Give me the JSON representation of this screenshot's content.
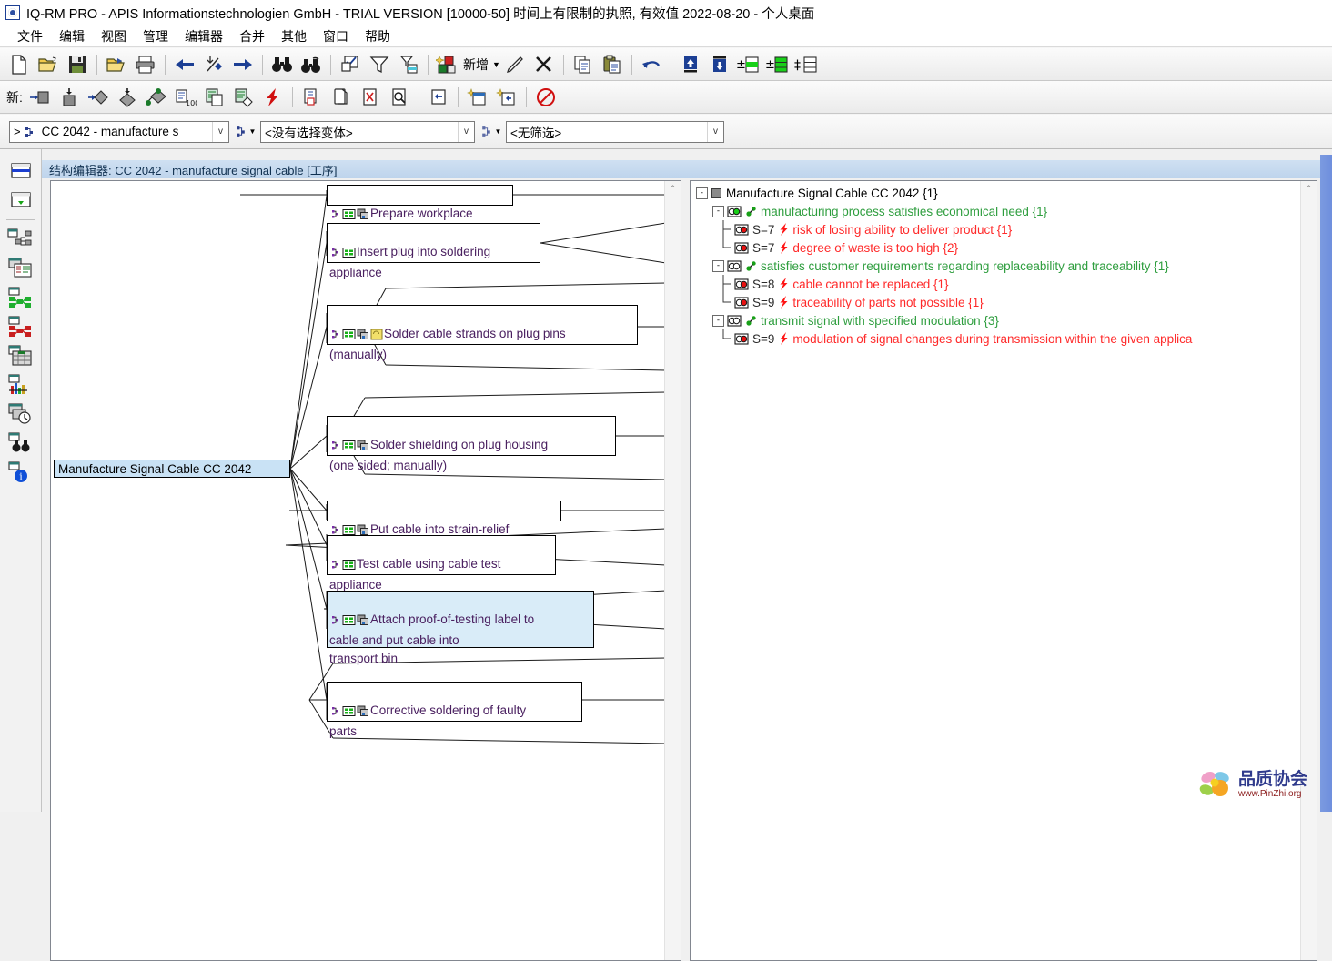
{
  "window": {
    "title": "IQ-RM PRO - APIS Informationstechnologien GmbH -  TRIAL VERSION [10000-50] 时间上有限制的执照, 有效值 2022-08-20 - 个人桌面",
    "app_icon": "apis-app-icon"
  },
  "menubar": {
    "items": [
      {
        "label": "文件",
        "name": "menu-file"
      },
      {
        "label": "编辑",
        "name": "menu-edit"
      },
      {
        "label": "视图",
        "name": "menu-view"
      },
      {
        "label": "管理",
        "name": "menu-manage"
      },
      {
        "label": "编辑器",
        "name": "menu-editor"
      },
      {
        "label": "合并",
        "name": "menu-merge"
      },
      {
        "label": "其他",
        "name": "menu-other"
      },
      {
        "label": "窗口",
        "name": "menu-window"
      },
      {
        "label": "帮助",
        "name": "menu-help"
      }
    ]
  },
  "toolbar_primary": {
    "new_label": "新增",
    "caret": "▼",
    "buttons": [
      {
        "name": "new-document-icon",
        "tip": "新建"
      },
      {
        "name": "open-folder-icon",
        "tip": "打开"
      },
      {
        "name": "save-disk-icon",
        "tip": "保存"
      },
      {
        "name": "print-preview-icon",
        "tip": "打印预览"
      },
      {
        "name": "print-icon",
        "tip": "打印"
      },
      {
        "name": "back-arrow-icon",
        "tip": "后退"
      },
      {
        "name": "jump-to-icon",
        "tip": "跳转"
      },
      {
        "name": "forward-arrow-icon",
        "tip": "前进"
      },
      {
        "name": "find-binoculars-icon",
        "tip": "查找"
      },
      {
        "name": "find-again-binoculars-icon",
        "tip": "再次查找"
      },
      {
        "name": "checkbox-list-icon",
        "tip": "选择"
      },
      {
        "name": "filter-funnel-icon",
        "tip": "筛选"
      },
      {
        "name": "filter-table-icon",
        "tip": "筛选表"
      },
      {
        "name": "new-object-icon",
        "tip": "新增对象"
      },
      {
        "name": "edit-pencil-icon",
        "tip": "编辑"
      },
      {
        "name": "delete-x-icon",
        "tip": "删除"
      },
      {
        "name": "copy-icon",
        "tip": "复制"
      },
      {
        "name": "paste-clipboard-icon",
        "tip": "粘贴"
      },
      {
        "name": "undo-icon",
        "tip": "撤销"
      },
      {
        "name": "move-up-icon",
        "tip": "上移"
      },
      {
        "name": "move-down-icon",
        "tip": "下移"
      },
      {
        "name": "expand-level-icon",
        "tip": "展开层级"
      },
      {
        "name": "expand-all-icon",
        "tip": "全部展开"
      },
      {
        "name": "insert-level-icon",
        "tip": "插入层级"
      }
    ]
  },
  "toolbar_secondary": {
    "prefix_label": "新:",
    "buttons": [
      {
        "name": "new-system-element-icon",
        "tip": "新系统元素"
      },
      {
        "name": "new-element-below-icon",
        "tip": "新元素"
      },
      {
        "name": "new-function-icon",
        "tip": "新功能"
      },
      {
        "name": "new-function-below-icon",
        "tip": "新功能下层"
      },
      {
        "name": "new-characteristic-icon",
        "tip": "新特性"
      },
      {
        "name": "new-measure-100-icon",
        "tip": "新措施"
      },
      {
        "name": "new-form-sheet-icon",
        "tip": "新表单"
      },
      {
        "name": "new-form-characteristic-icon",
        "tip": "新表单特性"
      },
      {
        "name": "new-failure-icon",
        "tip": "新失效"
      },
      {
        "name": "copy-object-icon",
        "tip": "复制对象"
      },
      {
        "name": "duplicate-icon",
        "tip": "副本"
      },
      {
        "name": "delete-object-icon",
        "tip": "删除对象"
      },
      {
        "name": "inspect-object-icon",
        "tip": "检查对象"
      },
      {
        "name": "indent-left-icon",
        "tip": "左缩进"
      },
      {
        "name": "new-row-above-icon",
        "tip": "上方插入行"
      },
      {
        "name": "new-row-right-icon",
        "tip": "右方插入行"
      },
      {
        "name": "no-entry-icon",
        "tip": "禁止"
      }
    ]
  },
  "combo_row": {
    "structure_combo": {
      "value": "CC 2042 - manufacture s",
      "prefix": ">",
      "icon": "structure-icon"
    },
    "variant_combo": {
      "value": "<没有选择变体>"
    },
    "filter_combo": {
      "value": "<无筛选>"
    },
    "mini_button_1": {
      "icon": "structure-small-icon",
      "caret": "▼"
    },
    "mini_button_2": {
      "icon": "variant-small-icon",
      "caret": "▼"
    },
    "dropdown_glyph": "v"
  },
  "document": {
    "title": "结构编辑器: CC 2042 - manufacture signal cable [工序]"
  },
  "sidebar": {
    "items": [
      {
        "name": "sidebar-item-structure-list",
        "icon": "list-blue-bar-icon"
      },
      {
        "name": "sidebar-item-import-down",
        "icon": "list-green-arrow-icon"
      },
      {
        "name": "sidebar-item-structure-tree",
        "icon": "structure-network-icon"
      },
      {
        "name": "sidebar-item-form-sheet",
        "icon": "form-sheet-icon"
      },
      {
        "name": "sidebar-item-function-net",
        "icon": "function-net-green-icon"
      },
      {
        "name": "sidebar-item-failure-net",
        "icon": "failure-net-red-icon"
      },
      {
        "name": "sidebar-item-matrix",
        "icon": "matrix-grid-icon"
      },
      {
        "name": "sidebar-item-chart",
        "icon": "bar-chart-icon"
      },
      {
        "name": "sidebar-item-schedule",
        "icon": "schedule-clock-icon"
      },
      {
        "name": "sidebar-item-search",
        "icon": "binoculars-icon"
      },
      {
        "name": "sidebar-item-info",
        "icon": "info-icon"
      }
    ]
  },
  "graph": {
    "root": {
      "label": "Manufacture Signal Cable CC 2042",
      "selected": true
    },
    "nodes": [
      {
        "label": "Prepare workplace",
        "icons": [
          "structure-icon",
          "form-icon",
          "copy-icon"
        ],
        "selected": false,
        "lines": 1
      },
      {
        "label": "Insert plug into soldering\nappliance",
        "icons": [
          "structure-icon",
          "form-icon"
        ],
        "selected": false,
        "lines": 2
      },
      {
        "label": "Solder cable strands on plug pins\n(manually)",
        "icons": [
          "structure-icon",
          "form-icon",
          "copy-icon",
          "note-icon"
        ],
        "selected": false,
        "lines": 2
      },
      {
        "label": "Solder shielding on plug housing\n(one sided; manually)",
        "icons": [
          "structure-icon",
          "form-icon",
          "copy-icon"
        ],
        "selected": false,
        "lines": 2
      },
      {
        "label": "Put cable into strain-relief",
        "icons": [
          "structure-icon",
          "form-icon",
          "copy-icon"
        ],
        "selected": false,
        "lines": 1
      },
      {
        "label": "Test cable using cable test\nappliance",
        "icons": [
          "structure-icon",
          "form-icon"
        ],
        "selected": false,
        "lines": 2
      },
      {
        "label": "Attach proof-of-testing label to\ncable and put cable into\ntransport bin",
        "icons": [
          "structure-icon",
          "form-icon",
          "copy-icon"
        ],
        "selected": true,
        "lines": 3
      },
      {
        "label": "Corrective soldering of faulty\nparts",
        "icons": [
          "structure-icon",
          "form-icon",
          "copy-icon"
        ],
        "selected": false,
        "lines": 2
      }
    ],
    "scrollbar": {
      "up_arrow": "⌃"
    }
  },
  "tree": {
    "rows": [
      {
        "name": "tree-row-root",
        "depth": 0,
        "expander": "-",
        "icon": "system-element-icon",
        "severity": "",
        "bolt": false,
        "text": "Manufacture Signal Cable CC 2042 {1}",
        "color": "black",
        "elbow": "none"
      },
      {
        "name": "tree-row-function-1",
        "depth": 1,
        "expander": "-",
        "icon": "function-green-icon",
        "severity": "",
        "bolt": false,
        "text": "manufacturing process satisfies economical need {1}",
        "color": "green",
        "elbow": "none"
      },
      {
        "name": "tree-row-failure-1",
        "depth": 2,
        "expander": "",
        "icon": "failure-red-icon",
        "severity": "S=7",
        "bolt": true,
        "text": "risk of losing ability to deliver product {1}",
        "color": "red",
        "elbow": "tee"
      },
      {
        "name": "tree-row-failure-2",
        "depth": 2,
        "expander": "",
        "icon": "failure-red-icon",
        "severity": "S=7",
        "bolt": true,
        "text": "degree of waste is too high {2}",
        "color": "red",
        "elbow": "corner"
      },
      {
        "name": "tree-row-function-2",
        "depth": 1,
        "expander": "-",
        "icon": "function-outline-icon",
        "severity": "",
        "bolt": false,
        "text": "satisfies customer requirements regarding replaceability and traceability {1}",
        "color": "green",
        "elbow": "none"
      },
      {
        "name": "tree-row-failure-3",
        "depth": 2,
        "expander": "",
        "icon": "failure-red-icon",
        "severity": "S=8",
        "bolt": true,
        "text": "cable cannot be replaced {1}",
        "color": "red",
        "elbow": "tee"
      },
      {
        "name": "tree-row-failure-4",
        "depth": 2,
        "expander": "",
        "icon": "failure-red-icon",
        "severity": "S=9",
        "bolt": true,
        "text": "traceability of parts not possible {1}",
        "color": "red",
        "elbow": "corner"
      },
      {
        "name": "tree-row-function-3",
        "depth": 1,
        "expander": "-",
        "icon": "function-outline-icon",
        "severity": "",
        "bolt": false,
        "text": "transmit signal with specified modulation {3}",
        "color": "green",
        "elbow": "none"
      },
      {
        "name": "tree-row-failure-5",
        "depth": 2,
        "expander": "",
        "icon": "failure-red-icon",
        "severity": "S=9",
        "bolt": true,
        "text": "modulation of signal changes during transmission within the given applica",
        "color": "red",
        "elbow": "corner"
      }
    ],
    "scrollbar": {
      "up_arrow": "⌃"
    }
  },
  "watermark": {
    "chinese": "品质协会",
    "url": "www.PinZhi.org"
  },
  "colors": {
    "node_text": "#4a2060",
    "selection": "#c9e2f5",
    "tree_green": "#2f9e3f",
    "tree_red": "#ff2a2a",
    "title_band": "#cfe0f2",
    "outer_scroll": "#7b9ae0"
  }
}
